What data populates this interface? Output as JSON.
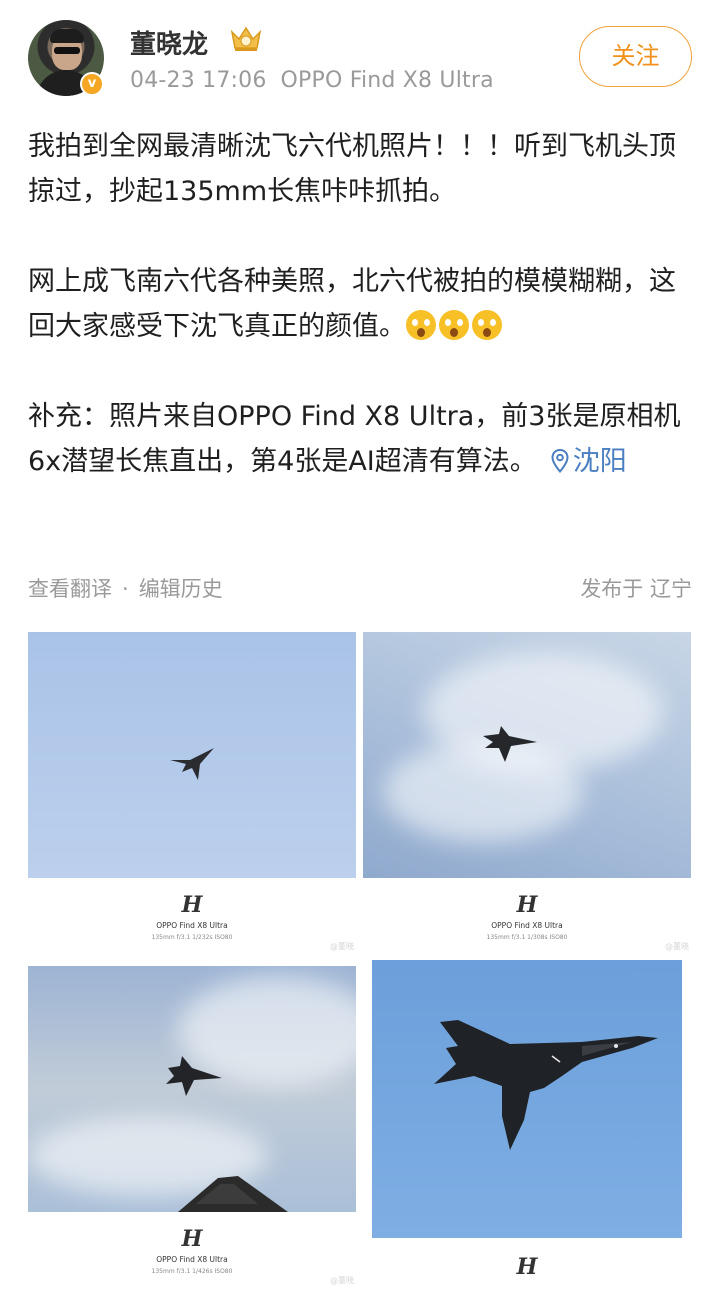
{
  "user": {
    "name": "董晓龙",
    "verify_badge": "v",
    "time": "04-23 17:06",
    "device": "OPPO Find X8 Ultra",
    "follow_label": "关注"
  },
  "post": {
    "paragraph1": "我拍到全网最清晰沈飞六代机照片！！！听到飞机头顶掠过，抄起135mm长焦咔咔抓拍。",
    "paragraph2": "网上成飞南六代各种美照，北六代被拍的模模糊糊，这回大家感受下沈飞真正的颜值。",
    "emoji_count": 3,
    "paragraph3": "补充：照片来自OPPO Find X8 Ultra，前3张是原相机6x潜望长焦直出，第4张是AI超清有算法。",
    "location": "沈阳"
  },
  "footer": {
    "translate": "查看翻译",
    "separator": "·",
    "edit_history": "编辑历史",
    "published_from": "发布于 辽宁"
  },
  "photos": [
    {
      "logo": "H",
      "device": "OPPO Find X8 Ultra",
      "params": "135mm  f/3.1  1/232s  ISO80",
      "watermark": "@董晓"
    },
    {
      "logo": "H",
      "device": "OPPO Find X8 Ultra",
      "params": "135mm  f/3.1  1/308s  ISO80",
      "watermark": "@董晓"
    },
    {
      "logo": "H",
      "device": "OPPO Find X8 Ultra",
      "params": "135mm  f/3.1  1/426s  ISO80",
      "watermark": "@董晓"
    },
    {
      "logo": "H"
    }
  ],
  "colors": {
    "accent": "#f0911c",
    "link": "#4a7fc1",
    "meta_gray": "#9a9a9a"
  }
}
